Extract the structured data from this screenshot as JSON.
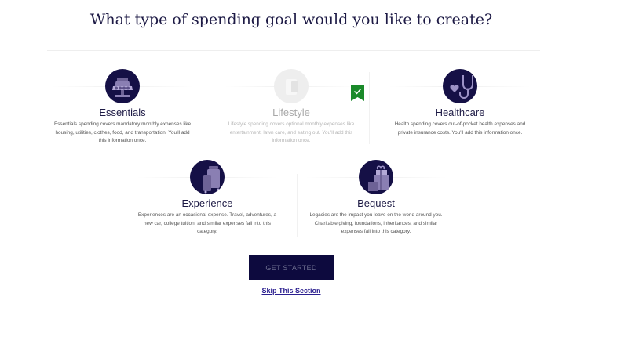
{
  "page": {
    "title": "What type of spending goal would you like to create?"
  },
  "goals": [
    {
      "label": "Essentials",
      "description": "Essentials spending covers mandatory monthly expenses like housing, utilities, clothes, food, and transportation. You'll add this information once.",
      "icon": "lamp-icon",
      "selected": false
    },
    {
      "label": "Lifestyle",
      "description": "Lifestyle spending covers optional monthly expenses like entertainment, lawn care, and eating out. You'll add this information once.",
      "icon": "lifestyle-icon",
      "selected": true
    },
    {
      "label": "Healthcare",
      "description": "Health spending covers out-of-pocket health expenses and private insurance costs. You'll add this information once.",
      "icon": "stethoscope-icon",
      "selected": false
    },
    {
      "label": "Experience",
      "description": "Experiences are an occasional expense. Travel, adventures, a new car, college tuition, and similar expenses fall into this category.",
      "icon": "suitcase-icon",
      "selected": false
    },
    {
      "label": "Bequest",
      "description": "Legacies are the impact you leave on the world around you. Charitable giving, foundations, inheritances, and similar expenses fall into this category.",
      "icon": "gift-icon",
      "selected": false
    }
  ],
  "actions": {
    "primary_label": "GET STARTED",
    "skip_label": "Skip This Section"
  },
  "colors": {
    "navy": "#151046",
    "button_bg": "#0d0a3e",
    "check_green": "#1a8a2a",
    "link": "#2b1f8f"
  }
}
